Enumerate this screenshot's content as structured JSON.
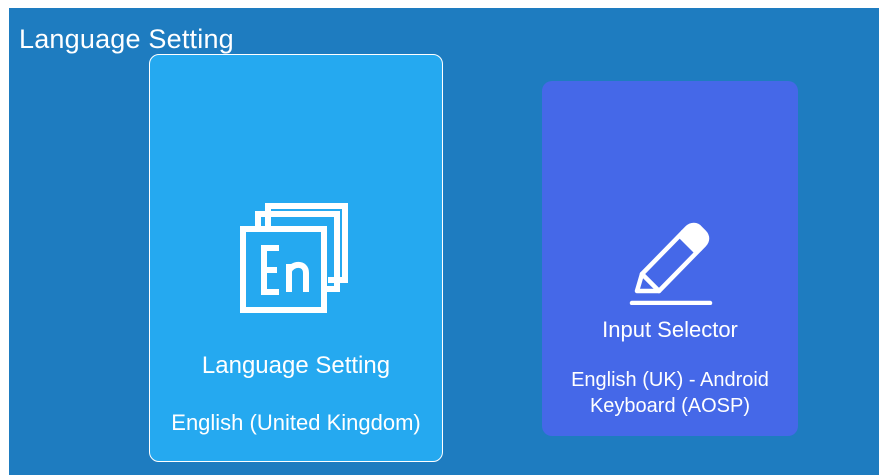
{
  "header": {
    "title": "Language Setting"
  },
  "cards": [
    {
      "icon": "language-en-icon",
      "title": "Language Setting",
      "subtitle": "English (United Kingdom)",
      "color": "#25a9f0",
      "selected": true
    },
    {
      "icon": "pencil-icon",
      "title": "Input Selector",
      "subtitle": "English (UK) - Android Keyboard (AOSP)",
      "color": "#4568e8",
      "selected": false
    }
  ],
  "colors": {
    "background": "#1e7cc0",
    "text": "#ffffff"
  }
}
